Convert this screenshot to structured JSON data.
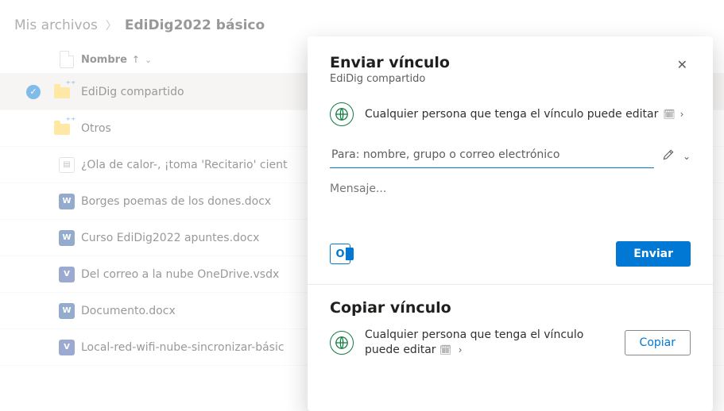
{
  "breadcrumb": {
    "parent": "Mis archivos",
    "current": "EdiDig2022 básico"
  },
  "listHeader": {
    "name": "Nombre"
  },
  "files": [
    {
      "name": "EdiDig compartido",
      "kind": "folder-shared",
      "selected": true,
      "hovered": true
    },
    {
      "name": "Otros",
      "kind": "folder-shared"
    },
    {
      "name": "¿Ola de calor-, ¡toma 'Recitario' cient",
      "kind": "template"
    },
    {
      "name": "Borges poemas de los dones.docx",
      "kind": "word"
    },
    {
      "name": "Curso EdiDig2022 apuntes.docx",
      "kind": "word"
    },
    {
      "name": "Del correo a la nube OneDrive.vsdx",
      "kind": "visio"
    },
    {
      "name": "Documento.docx",
      "kind": "word"
    },
    {
      "name": "Local-red-wifi-nube-sincronizar-básic",
      "kind": "visio"
    }
  ],
  "modal": {
    "title": "Enviar vínculo",
    "subtitle": "EdiDig compartido",
    "scope": {
      "text": "Cualquier persona que tenga el vínculo puede editar"
    },
    "toPlaceholder": "Para: nombre, grupo o correo electrónico",
    "messagePlaceholder": "Mensaje...",
    "sendLabel": "Enviar",
    "copySection": {
      "title": "Copiar vínculo",
      "text": "Cualquier persona que tenga el vínculo puede editar",
      "buttonLabel": "Copiar"
    }
  }
}
